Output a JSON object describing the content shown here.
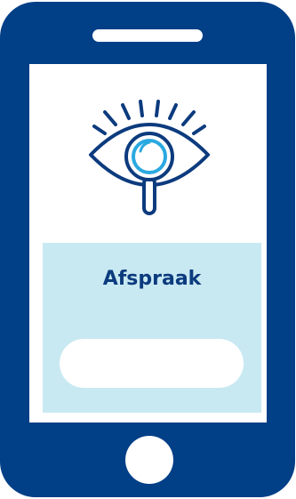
{
  "card": {
    "title": "Afspraak",
    "input_value": ""
  },
  "illustration": {
    "icon": "eye-magnifier-icon"
  },
  "colors": {
    "phone_body": "#013f87",
    "card_background": "#c9e9f2",
    "title_text": "#0c3b7e",
    "eye_outline": "#0c3b7e",
    "lens_accent": "#2aa9e0"
  }
}
